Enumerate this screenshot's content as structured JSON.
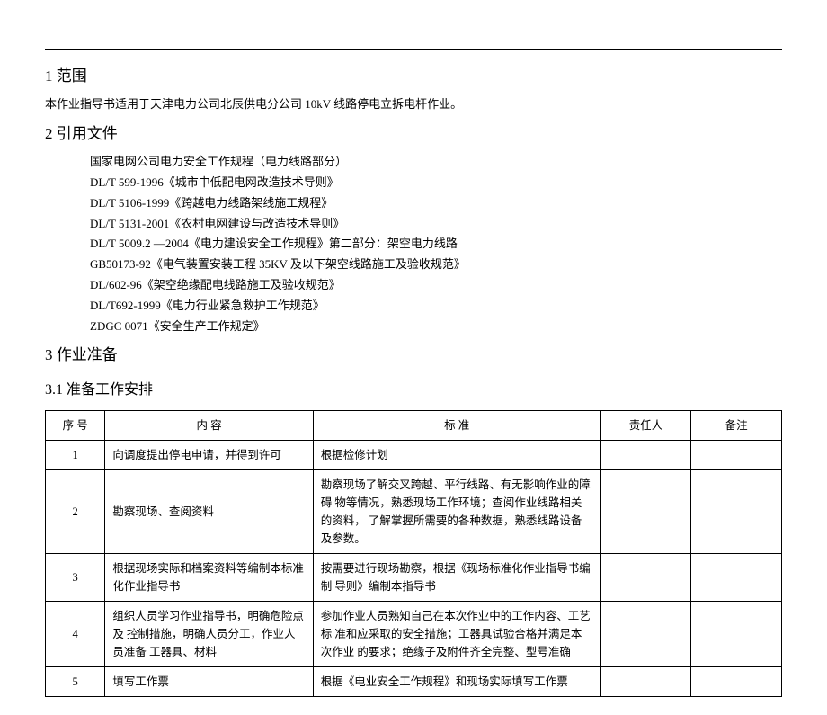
{
  "section1": {
    "heading": "1 范围",
    "body": "本作业指导书适用于天津电力公司北辰供电分公司 10kV 线路停电立拆电杆作业。"
  },
  "section2": {
    "heading": "2 引用文件",
    "refs": [
      "国家电网公司电力安全工作规程（电力线路部分）",
      "DL/T 599-1996《城市中低配电网改造技术导则》",
      "DL/T 5106-1999《跨越电力线路架线施工规程》",
      "DL/T 5131-2001《农村电网建设与改造技术导则》",
      "DL/T 5009.2 —2004《电力建设安全工作规程》第二部分：架空电力线路",
      "GB50173-92《电气装置安装工程  35KV 及以下架空线路施工及验收规范》",
      "DL/602-96《架空绝缘配电线路施工及验收规范》",
      "DL/T692-1999《电力行业紧急救护工作规范》",
      "ZDGC 0071《安全生产工作规定》"
    ]
  },
  "section3": {
    "heading": "3 作业准备",
    "sub1": {
      "heading": "3.1 准备工作安排",
      "table": {
        "headers": {
          "seq": "序 号",
          "content": "内 容",
          "standard": "标  准",
          "resp": "责任人",
          "note": "备注"
        },
        "rows": [
          {
            "seq": "1",
            "content": "向调度提出停电申请，并得到许可",
            "standard": "根据检修计划",
            "resp": "",
            "note": ""
          },
          {
            "seq": "2",
            "content": "勘察现场、查阅资料",
            "standard": "勘察现场了解交叉跨越、平行线路、有无影响作业的障碍  物等情况，熟悉现场工作环境；查阅作业线路相关的资料，  了解掌握所需要的各种数据，熟悉线路设备及参数。",
            "resp": "",
            "note": ""
          },
          {
            "seq": "3",
            "content": "根据现场实际和档案资料等编制本标准  化作业指导书",
            "standard": "按需要进行现场勘察，根据《现场标准化作业指导书编制  导则》编制本指导书",
            "resp": "",
            "note": ""
          },
          {
            "seq": "4",
            "content": "组织人员学习作业指导书，明确危险点及  控制措施，明确人员分工，作业人员准备  工器具、材料",
            "standard": "参加作业人员熟知自己在本次作业中的工作内容、工艺标  准和应采取的安全措施；工器具试验合格并满足本次作业  的要求；绝缘子及附件齐全完整、型号准确",
            "resp": "",
            "note": ""
          },
          {
            "seq": "5",
            "content": "填写工作票",
            "standard": "根据《电业安全工作规程》和现场实际填写工作票",
            "resp": "",
            "note": ""
          }
        ]
      }
    }
  }
}
